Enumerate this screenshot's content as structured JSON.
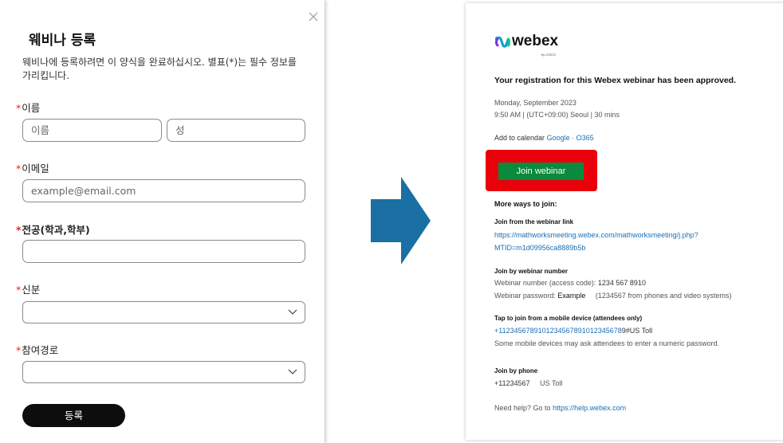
{
  "registration_form": {
    "title": "웨비나 등록",
    "description": "웨비나에 등록하려면 이 양식을 완료하십시오. 별표(*)는 필수 정보를 가리킵니다.",
    "required_marker": "*",
    "name": {
      "label": "이름",
      "first_placeholder": "이름",
      "last_placeholder": "성"
    },
    "email": {
      "label": "이메일",
      "placeholder": "example@email.com"
    },
    "major": {
      "label": "전공(학과,학부)",
      "value": ""
    },
    "status": {
      "label": "신분",
      "selected": ""
    },
    "referral": {
      "label": "참여경로",
      "selected": ""
    },
    "submit_label": "등록",
    "close_icon": "close-icon"
  },
  "transition_arrow": {
    "icon": "right-arrow-icon",
    "color": "#1a6fa3"
  },
  "email": {
    "logo_text": "webex",
    "logo_sub": "by CISCO",
    "headline": "Your registration for this Webex webinar has been approved.",
    "date": "Monday, September     2023",
    "time": "9:50 AM  |  (UTC+09:00) Seoul  |  30 mins",
    "calendar_prefix": "Add to calendar",
    "calendar_google": "Google",
    "calendar_sep": " · ",
    "calendar_o365": "O365",
    "join_button": "Join webinar",
    "join_highlight_color": "#e8000b",
    "join_button_color": "#0a8a3c",
    "more_ways": "More ways to join:",
    "link_section": {
      "title": "Join from the webinar link",
      "url_line1": "https://mathworksmeeting.webex.com/mathworksmeeting/j.php?",
      "url_line2": "MTID=m1d09956ca8889b5b"
    },
    "number_section": {
      "title": "Join by webinar number",
      "number_label": "Webinar number (access code): ",
      "number_value": "1234 567 8910",
      "password_label": "Webinar password: ",
      "password_value": "Example",
      "password_note": "(1234567  from phones and video systems)"
    },
    "mobile_section": {
      "title": "Tap to join from a mobile device (attendees only)",
      "tap_number": "+1123456789101234567891012345678",
      "tap_suffix": "9#US Toll",
      "note": "Some mobile devices may ask attendees to enter a numeric password."
    },
    "phone_section": {
      "title": "Join by phone",
      "number": "+11234567",
      "toll": "US Toll"
    },
    "help_prefix": "Need help? Go to ",
    "help_link": "https://help.webex.com"
  }
}
